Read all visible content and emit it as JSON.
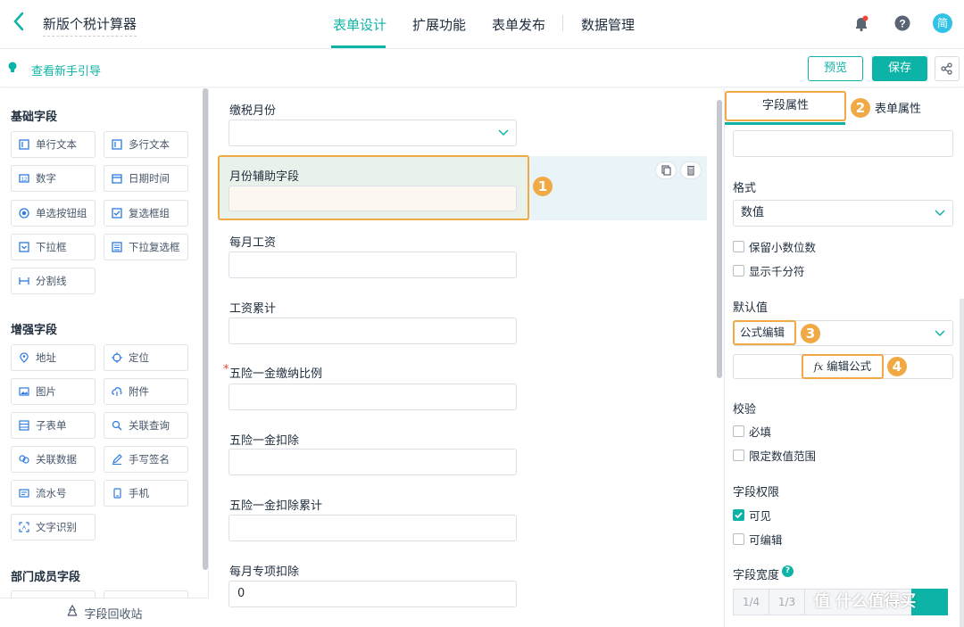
{
  "header": {
    "title": "新版个税计算器",
    "tabs": [
      "表单设计",
      "扩展功能",
      "表单发布",
      "数据管理"
    ],
    "avatar_text": "简"
  },
  "guide": {
    "link": "查看新手引导",
    "preview": "预览",
    "save": "保存"
  },
  "left": {
    "basic_title": "基础字段",
    "basic": [
      "单行文本",
      "多行文本",
      "数字",
      "日期时间",
      "单选按钮组",
      "复选框组",
      "下拉框",
      "下拉复选框",
      "分割线"
    ],
    "enhanced_title": "增强字段",
    "enhanced": [
      "地址",
      "定位",
      "图片",
      "附件",
      "子表单",
      "关联查询",
      "关联数据",
      "手写签名",
      "流水号",
      "手机",
      "文字识别"
    ],
    "dept_title": "部门成员字段",
    "recycle": "字段回收站"
  },
  "canvas": {
    "fields": [
      {
        "label": "缴税月份",
        "value": ""
      },
      {
        "label": "月份辅助字段",
        "value": ""
      },
      {
        "label": "每月工资",
        "value": ""
      },
      {
        "label": "工资累计",
        "value": ""
      },
      {
        "label": "五险一金缴纳比例",
        "value": "",
        "required": "*"
      },
      {
        "label": "五险一金扣除",
        "value": ""
      },
      {
        "label": "五险一金扣除累计",
        "value": ""
      },
      {
        "label": "每月专项扣除",
        "value": "0"
      }
    ]
  },
  "badges": [
    "1",
    "2",
    "3",
    "4"
  ],
  "right": {
    "tab_field": "字段属性",
    "tab_form": "表单属性",
    "format_label": "格式",
    "format_value": "数值",
    "keep_decimal": "保留小数位数",
    "thousands": "显示千分符",
    "default_label": "默认值",
    "default_value": "公式编辑",
    "edit_formula": "编辑公式",
    "fx": "fx",
    "validate_label": "校验",
    "required": "必填",
    "limit_range": "限定数值范围",
    "perm_label": "字段权限",
    "visible": "可见",
    "editable": "可编辑",
    "width_label": "字段宽度",
    "width_options": [
      "1/4",
      "1/3"
    ],
    "watermark": "值 什么值得买",
    "checks": {
      "keep_decimal": false,
      "thousands": false,
      "required": false,
      "limit_range": false,
      "visible": true,
      "editable": false
    }
  },
  "colors": {
    "accent": "#0db3a6",
    "highlight": "#f0a944"
  }
}
